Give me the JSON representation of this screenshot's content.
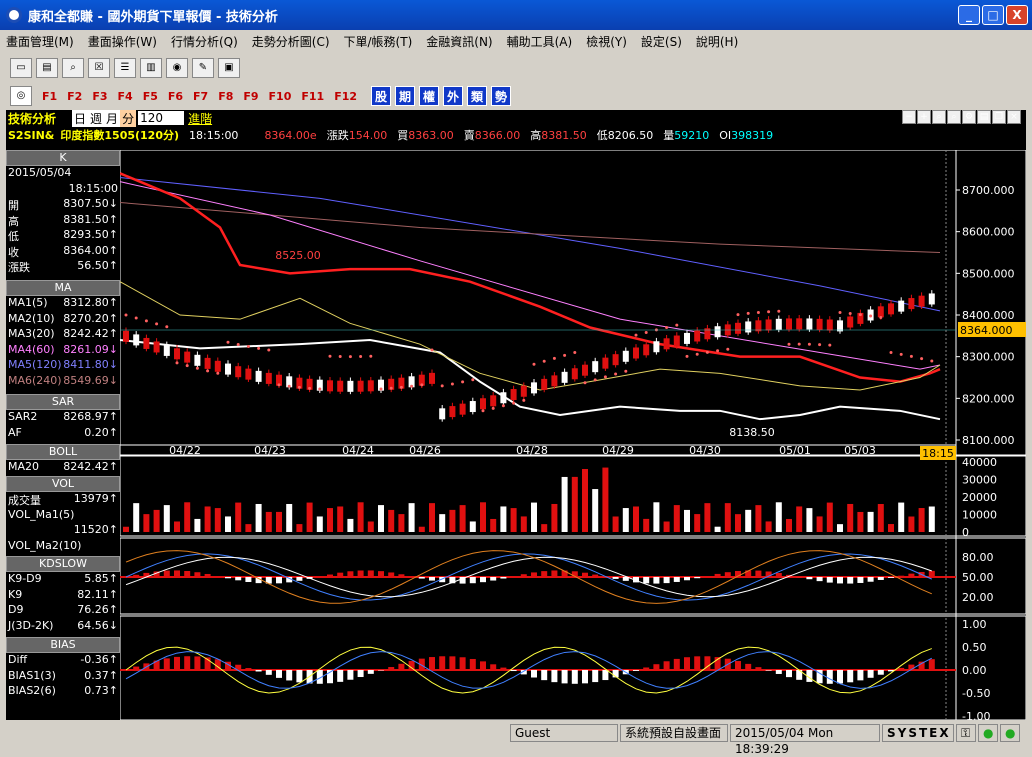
{
  "window": {
    "title": "康和全都賺 - 國外期貨下單報價 - 技術分析",
    "btn_min": "_",
    "btn_max": "□",
    "btn_close": "X"
  },
  "menu": [
    "畫面管理(M)",
    "畫面操作(W)",
    "行情分析(Q)",
    "走勢分析圖(C)",
    "下單/帳務(T)",
    "金融資訊(N)",
    "輔助工具(A)",
    "檢視(Y)",
    "設定(S)",
    "說明(H)"
  ],
  "fkeys": [
    "F1",
    "F2",
    "F3",
    "F4",
    "F5",
    "F6",
    "F7",
    "F8",
    "F9",
    "F10",
    "F11",
    "F12"
  ],
  "cat_buttons": [
    "股",
    "期",
    "權",
    "外",
    "類",
    "勢"
  ],
  "header": {
    "title": "技術分析",
    "period_day": "日",
    "period_week": "週",
    "period_month": "月",
    "period_min": "分",
    "period_value": "120",
    "advanced": "進階",
    "symbol": "S2SIN&",
    "name": "印度指數1505(120分)",
    "time": "18:15:00",
    "last": "8364.00e",
    "chg_label": "漲跌",
    "chg": "154.00",
    "bid_label": "買",
    "bid": "8363.00",
    "ask_label": "賣",
    "ask": "8366.00",
    "high_label": "高",
    "high": "8381.50",
    "low_label": "低",
    "low": "8206.50",
    "vol_label": "量",
    "vol": "59210",
    "oi_label": "OI",
    "oi": "398319"
  },
  "panel_k": {
    "title": "K",
    "date": "2015/05/04",
    "time": "18:15:00",
    "rows": [
      {
        "l": "開",
        "v": "8307.50↓"
      },
      {
        "l": "高",
        "v": "8381.50↑"
      },
      {
        "l": "低",
        "v": "8293.50↑"
      },
      {
        "l": "收",
        "v": "8364.00↑"
      },
      {
        "l": "漲跌",
        "v": "56.50↑"
      }
    ]
  },
  "panel_ma": {
    "title": "MA",
    "rows": [
      {
        "l": "MA1(5)",
        "v": "8312.80↑",
        "c": "#ffffff"
      },
      {
        "l": "MA2(10)",
        "v": "8270.20↑",
        "c": "#ffffff"
      },
      {
        "l": "MA3(20)",
        "v": "8242.42↑",
        "c": "#ffffff"
      },
      {
        "l": "MA4(60)",
        "v": "8261.09↓",
        "c": "#ff80ff"
      },
      {
        "l": "MA5(120)",
        "v": "8411.80↓",
        "c": "#8080ff"
      },
      {
        "l": "MA6(240)",
        "v": "8549.69↓",
        "c": "#c08080"
      }
    ]
  },
  "panel_sar": {
    "title": "SAR",
    "rows": [
      {
        "l": "SAR2",
        "v": "8268.97↑"
      },
      {
        "l": "AF",
        "v": "0.20↑"
      }
    ]
  },
  "panel_boll": {
    "title": "BOLL",
    "rows": [
      {
        "l": "MA20",
        "v": "8242.42↑"
      }
    ]
  },
  "panel_vol": {
    "title": "VOL",
    "rows": [
      {
        "l": "成交量",
        "v": "13979↑"
      },
      {
        "l": "VOL_Ma1(5)",
        "v": ""
      },
      {
        "l": "",
        "v": "11520↑"
      },
      {
        "l": "VOL_Ma2(10)",
        "v": ""
      }
    ]
  },
  "panel_kd": {
    "title": "KDSLOW",
    "rows": [
      {
        "l": "K9-D9",
        "v": "5.85↑"
      },
      {
        "l": "K9",
        "v": "82.11↑"
      },
      {
        "l": "D9",
        "v": "76.26↑"
      },
      {
        "l": "J(3D-2K)",
        "v": "64.56↓"
      }
    ]
  },
  "panel_bias": {
    "title": "BIAS",
    "rows": [
      {
        "l": "Diff",
        "v": "-0.36↑"
      },
      {
        "l": "BIAS1(3)",
        "v": "0.37↑"
      },
      {
        "l": "BIAS2(6)",
        "v": "0.73↑"
      }
    ]
  },
  "price_axis": [
    "8700.000",
    "8600.000",
    "8500.000",
    "8400.000",
    "8300.000",
    "8200.000",
    "8100.000"
  ],
  "current_price_tag": "8364.000",
  "price_annotations": {
    "high": "8525.00",
    "low": "8138.50"
  },
  "date_axis": [
    "04/22",
    "04/23",
    "04/24",
    "04/26",
    "04/28",
    "04/29",
    "04/30",
    "05/01",
    "05/03"
  ],
  "time_tag": "18:15",
  "vol_axis": [
    "40000",
    "30000",
    "20000",
    "10000",
    "0"
  ],
  "kd_axis": [
    "80.00",
    "50.00",
    "20.00"
  ],
  "bias_axis": [
    "1.00",
    "0.50",
    "0.00",
    "-0.50",
    "-1.00"
  ],
  "status": {
    "user": "Guest",
    "layout": "系統預設自設畫面",
    "datetime": "2015/05/04 Mon 18:39:29",
    "brand": "SYSTEX"
  },
  "colors": {
    "title_bg": "#0a48c8",
    "up": "#e01010",
    "down": "#ffffff",
    "bg": "#000000"
  }
}
